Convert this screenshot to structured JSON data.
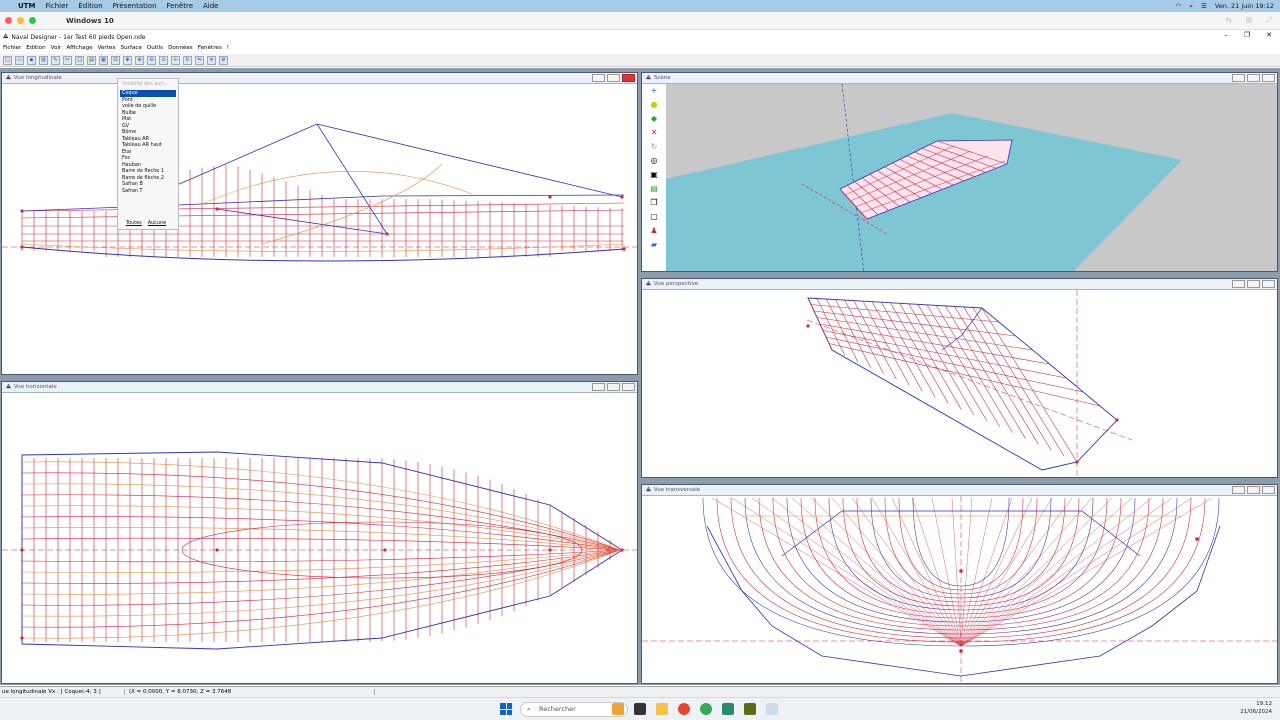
{
  "mac_menu": {
    "apple": "",
    "app": "UTM",
    "items": [
      "Fichier",
      "Édition",
      "Présentation",
      "Fenêtre",
      "Aide"
    ],
    "clock": "Ven. 21 juin 19:12"
  },
  "utm": {
    "window_title": "Windows 10"
  },
  "app": {
    "title": "Naval Designer - 1er Test 60 pieds Open.nde",
    "menus": [
      "Fichier",
      "Edition",
      "Voir",
      "Affichage",
      "Vertex",
      "Surface",
      "Outils",
      "Données",
      "Fenêtres",
      "!"
    ]
  },
  "windows": {
    "longitudinal": "Vue longitudinale",
    "horizontal": "Vue horizontale",
    "view3d": "Scène",
    "perspective": "Vue perspective",
    "transversal": "Vue transversale"
  },
  "popup": {
    "header": "Visibilité des surf...",
    "items": [
      "Coque",
      "Pont",
      "voile de quille",
      "Bulbe",
      "Mat",
      "GV",
      "Bôme",
      "Tableau AR",
      "Tableau AR haut",
      "Etai",
      "Foc",
      "Hauban",
      "Barre de flèche 1",
      "Barre de flèche 2",
      "Safran B",
      "Safran T"
    ],
    "selected": 0,
    "all": "Toutes",
    "none": "Aucune"
  },
  "status": {
    "view": "ue longitudinale Vx : [ Coque(-4; 3 ]",
    "coords": "(X = 0.0000, Y = 8.0730; Z = 3.7648"
  },
  "taskbar": {
    "search_placeholder": "Rechercher",
    "time": "19:12",
    "date": "21/06/2024"
  },
  "colors": {
    "hull_red": "#e0203a",
    "hull_blue": "#3030c8",
    "sea": "#7fc6d4",
    "orange": "#e8903a"
  }
}
